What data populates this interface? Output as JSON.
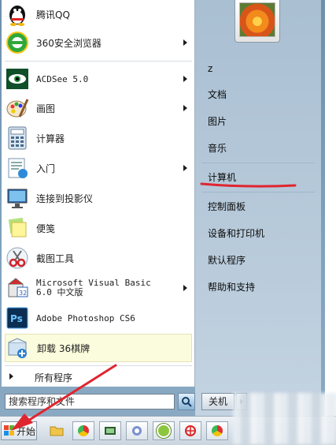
{
  "start_menu": {
    "programs": [
      {
        "label": "腾讯QQ",
        "icon": "qq-penguin-icon",
        "submenu": false
      },
      {
        "label": "360安全浏览器",
        "icon": "360-browser-icon",
        "submenu": true
      },
      {
        "label": "ACDSee 5.0",
        "icon": "acdsee-eye-icon",
        "submenu": true
      },
      {
        "label": "画图",
        "icon": "paint-palette-icon",
        "submenu": true
      },
      {
        "label": "计算器",
        "icon": "calculator-icon",
        "submenu": false
      },
      {
        "label": "入门",
        "icon": "getting-started-icon",
        "submenu": true
      },
      {
        "label": "连接到投影仪",
        "icon": "projector-monitor-icon",
        "submenu": false
      },
      {
        "label": "便笺",
        "icon": "sticky-notes-icon",
        "submenu": false
      },
      {
        "label": "截图工具",
        "icon": "scissors-icon",
        "submenu": false
      },
      {
        "label": "Microsoft Visual Basic 6.0 中文版",
        "icon": "visual-basic-icon",
        "submenu": true
      },
      {
        "label": "Adobe Photoshop CS6",
        "icon": "photoshop-icon",
        "submenu": false
      },
      {
        "label": "卸载 36棋牌",
        "icon": "uninstall-icon",
        "submenu": false
      }
    ],
    "all_programs": "所有程序",
    "search_placeholder": "搜索程序和文件",
    "right_links": [
      "z",
      "文档",
      "图片",
      "音乐",
      "计算机",
      "控制面板",
      "设备和打印机",
      "默认程序",
      "帮助和支持"
    ],
    "shutdown": "关机"
  },
  "taskbar": {
    "start_label": "开始",
    "pinned": [
      "folder-icon",
      "chrome-icon",
      "media-icon",
      "network-icon",
      "green-app-icon",
      "target-icon",
      "chrome-icon-2"
    ]
  },
  "annotation_color": "#e0252f"
}
